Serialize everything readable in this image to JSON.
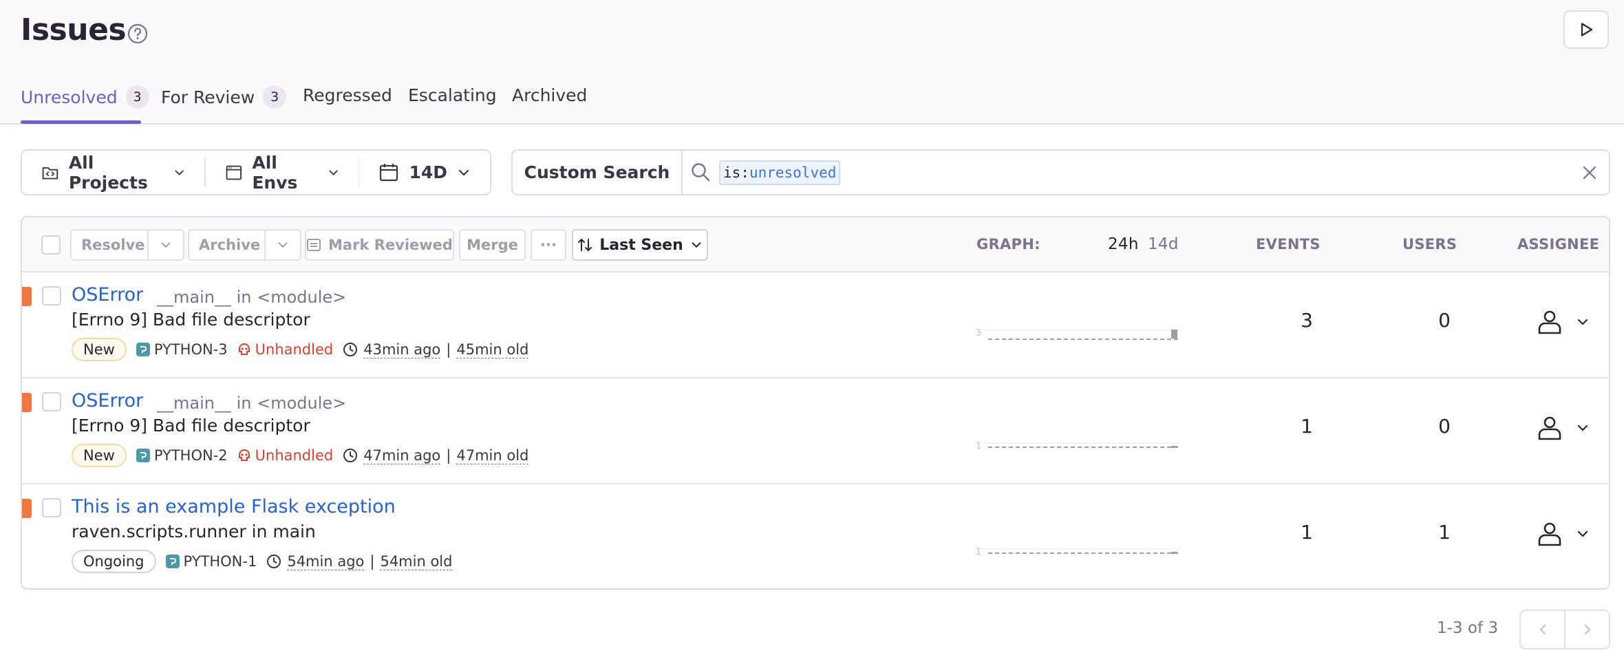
{
  "page": {
    "title": "Issues"
  },
  "tabs": [
    {
      "label": "Unresolved",
      "count": "3"
    },
    {
      "label": "For Review",
      "count": "3"
    },
    {
      "label": "Regressed"
    },
    {
      "label": "Escalating"
    },
    {
      "label": "Archived"
    }
  ],
  "filters": {
    "projects": "All Projects",
    "envs": "All Envs",
    "period": "14D"
  },
  "search": {
    "custom_label": "Custom Search",
    "token_key": "is:",
    "token_value": "unresolved"
  },
  "actions": {
    "resolve": "Resolve",
    "archive": "Archive",
    "mark_reviewed": "Mark Reviewed",
    "merge": "Merge",
    "more": "···",
    "sort": "Last Seen"
  },
  "columns": {
    "graph": "GRAPH:",
    "period_24h": "24h",
    "period_14d": "14d",
    "events": "EVENTS",
    "users": "USERS",
    "assignee": "ASSIGNEE"
  },
  "issues": [
    {
      "title": "OSError",
      "culprit": "__main__ in <module>",
      "message": "[Errno 9] Bad file descriptor",
      "status": "New",
      "project": "PYTHON-3",
      "unhandled": "Unhandled",
      "last_seen": "43min ago",
      "age": "45min old",
      "graph_max": "3",
      "events": "3",
      "users": "0"
    },
    {
      "title": "OSError",
      "culprit": "__main__ in <module>",
      "message": "[Errno 9] Bad file descriptor",
      "status": "New",
      "project": "PYTHON-2",
      "unhandled": "Unhandled",
      "last_seen": "47min ago",
      "age": "47min old",
      "graph_max": "1",
      "events": "1",
      "users": "0"
    },
    {
      "title": "This is an example Flask exception",
      "culprit": "",
      "message": "raven.scripts.runner in main",
      "status": "Ongoing",
      "project": "PYTHON-1",
      "unhandled": "",
      "last_seen": "54min ago",
      "age": "54min old",
      "graph_max": "1",
      "events": "1",
      "users": "1"
    }
  ],
  "pagination": {
    "label": "1-3 of 3"
  },
  "colors": {
    "accent": "#6c5fc7",
    "link": "#2562d4",
    "level_error": "#f0783c",
    "unhandled": "#e03e2f"
  },
  "icons": [
    "help-icon",
    "play-icon",
    "folder-code-icon",
    "browser-window-icon",
    "calendar-icon",
    "chevron-down-icon",
    "search-icon",
    "close-icon",
    "reviewed-icon",
    "sort-icon",
    "python-icon",
    "skull-icon",
    "clock-icon",
    "user-icon",
    "chevron-left-icon",
    "chevron-right-icon"
  ]
}
